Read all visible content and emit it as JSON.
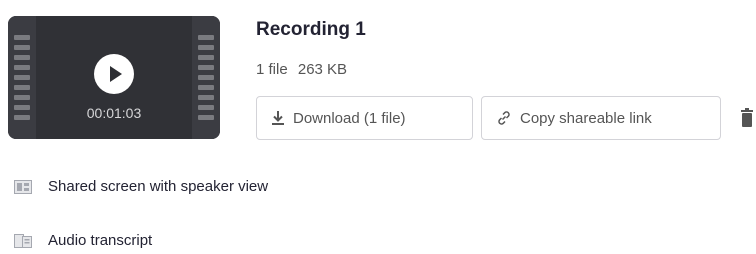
{
  "recording": {
    "title": "Recording 1",
    "file_count": "1 file",
    "size": "263 KB",
    "duration": "00:01:03"
  },
  "actions": {
    "download_label": "Download (1 file)",
    "copy_label": "Copy shareable link"
  },
  "files": [
    {
      "label": "Shared screen with speaker view",
      "icon": "video-file-icon"
    },
    {
      "label": "Audio transcript",
      "icon": "transcript-file-icon"
    }
  ],
  "colors": {
    "thumbnail_bg": "#2d2e33",
    "film_strip": "#3b3c42",
    "border": "#d3d3d8",
    "text": "#232333",
    "muted": "#555555"
  }
}
